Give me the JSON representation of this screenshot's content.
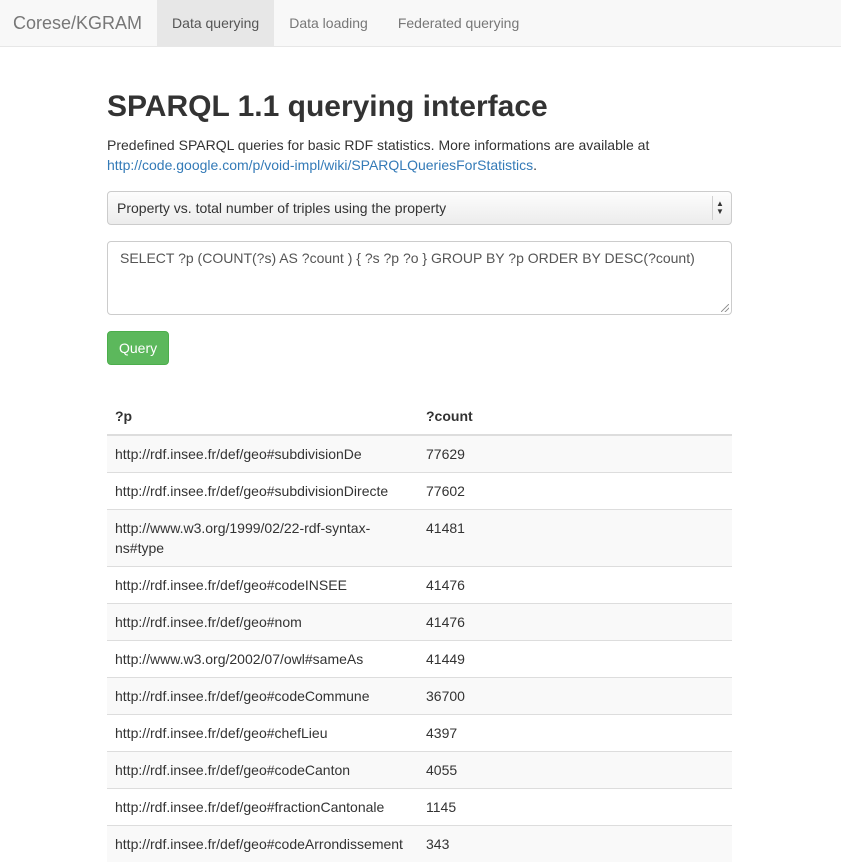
{
  "navbar": {
    "brand": "Corese/KGRAM",
    "tabs": [
      {
        "label": "Data querying",
        "active": true
      },
      {
        "label": "Data loading",
        "active": false
      },
      {
        "label": "Federated querying",
        "active": false
      }
    ]
  },
  "main": {
    "title": "SPARQL 1.1 querying interface",
    "lead_text": "Predefined SPARQL queries for basic RDF statistics. More informations are available at",
    "lead_link": "http://code.google.com/p/void-impl/wiki/SPARQLQueriesForStatistics",
    "lead_end": ".",
    "select_value": "Property vs. total number of triples using the property",
    "query_text": "SELECT  ?p (COUNT(?s) AS ?count ) { ?s ?p ?o } GROUP BY ?p ORDER BY DESC(?count)",
    "query_button": "Query"
  },
  "results": {
    "headers": [
      "?p",
      "?count"
    ],
    "rows": [
      [
        "http://rdf.insee.fr/def/geo#subdivisionDe",
        "77629"
      ],
      [
        "http://rdf.insee.fr/def/geo#subdivisionDirecte",
        "77602"
      ],
      [
        "http://www.w3.org/1999/02/22-rdf-syntax-ns#type",
        "41481"
      ],
      [
        "http://rdf.insee.fr/def/geo#codeINSEE",
        "41476"
      ],
      [
        "http://rdf.insee.fr/def/geo#nom",
        "41476"
      ],
      [
        "http://www.w3.org/2002/07/owl#sameAs",
        "41449"
      ],
      [
        "http://rdf.insee.fr/def/geo#codeCommune",
        "36700"
      ],
      [
        "http://rdf.insee.fr/def/geo#chefLieu",
        "4397"
      ],
      [
        "http://rdf.insee.fr/def/geo#codeCanton",
        "4055"
      ],
      [
        "http://rdf.insee.fr/def/geo#fractionCantonale",
        "1145"
      ],
      [
        "http://rdf.insee.fr/def/geo#codeArrondissement",
        "343"
      ]
    ]
  },
  "colors": {
    "accent": "#5cb85c",
    "link": "#337ab7",
    "navbar_bg": "#f8f8f8"
  }
}
